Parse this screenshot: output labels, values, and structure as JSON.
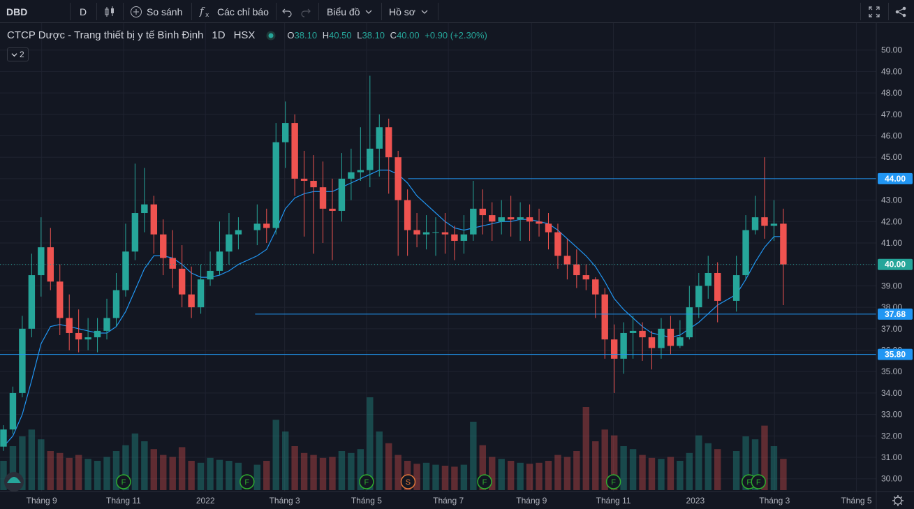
{
  "toolbar": {
    "symbol": "DBD",
    "interval": "D",
    "compare_label": "So sánh",
    "indicators_label": "Các chỉ báo",
    "chart_type_label": "Biểu đồ",
    "profile_label": "Hồ sơ"
  },
  "legend": {
    "title": "CTCP Dược - Trang thiết bị y tế Bình Định",
    "interval": "1D",
    "exchange": "HSX",
    "o_label": "O",
    "o_value": "38.10",
    "h_label": "H",
    "h_value": "40.50",
    "l_label": "L",
    "l_value": "38.10",
    "c_label": "C",
    "c_value": "40.00",
    "change": "+0.90 (+2.30%)",
    "collapsed_count": "2"
  },
  "colors": {
    "background": "#131722",
    "up": "#26a69a",
    "down": "#ef5350",
    "ma": "#2196f3",
    "hline": "#2196f3",
    "dividend_marker": "#2ead2e",
    "split_marker": "#e0763a"
  },
  "chart_data": {
    "type": "candlestick",
    "series": [
      {
        "name": "DBD",
        "x": [
          "2021-08-02",
          "2021-08-09",
          "2021-08-16",
          "2021-08-23",
          "2021-08-30",
          "2021-09-06",
          "2021-09-13",
          "2021-09-20",
          "2021-09-27",
          "2021-10-04",
          "2021-10-11",
          "2021-10-18",
          "2021-10-25",
          "2021-11-01",
          "2021-11-08",
          "2021-11-15",
          "2021-11-22",
          "2021-11-29",
          "2021-12-06",
          "2021-12-13",
          "2021-12-20",
          "2021-12-27",
          "2022-01-03",
          "2022-01-10",
          "2022-01-17",
          "2022-01-24",
          "2022-02-07",
          "2022-02-14",
          "2022-02-21",
          "2022-02-28",
          "2022-03-07",
          "2022-03-14",
          "2022-03-21",
          "2022-03-28",
          "2022-04-04",
          "2022-04-11",
          "2022-04-18",
          "2022-04-25",
          "2022-05-02",
          "2022-05-09",
          "2022-05-16",
          "2022-05-23",
          "2022-05-30",
          "2022-06-06",
          "2022-06-13",
          "2022-06-20",
          "2022-06-27",
          "2022-07-04",
          "2022-07-11",
          "2022-07-18",
          "2022-07-25",
          "2022-08-01",
          "2022-08-08",
          "2022-08-15",
          "2022-08-22",
          "2022-08-29",
          "2022-09-05",
          "2022-09-12",
          "2022-09-19",
          "2022-09-26",
          "2022-10-03",
          "2022-10-10",
          "2022-10-17",
          "2022-10-24",
          "2022-10-31",
          "2022-11-07",
          "2022-11-14",
          "2022-11-21",
          "2022-11-28",
          "2022-12-05",
          "2022-12-12",
          "2022-12-19",
          "2022-12-26",
          "2023-01-02",
          "2023-01-09",
          "2023-01-16",
          "2023-01-30",
          "2023-02-06",
          "2023-02-13",
          "2023-02-20",
          "2023-02-27",
          "2023-03-06"
        ],
        "open": [
          31.5,
          32.3,
          34.0,
          37.0,
          39.5,
          40.8,
          39.2,
          37.5,
          36.8,
          36.5,
          36.6,
          36.9,
          37.5,
          38.8,
          40.6,
          42.4,
          42.8,
          41.4,
          40.3,
          39.8,
          38.6,
          38.0,
          39.3,
          39.7,
          40.6,
          41.4,
          41.6,
          41.9,
          41.7,
          45.7,
          46.6,
          44.0,
          43.9,
          43.6,
          42.6,
          42.5,
          44.0,
          44.3,
          44.4,
          45.4,
          46.4,
          45.0,
          43.0,
          41.6,
          41.4,
          41.5,
          41.5,
          41.4,
          41.1,
          41.4,
          42.6,
          42.3,
          42.0,
          42.2,
          42.1,
          42.2,
          42.0,
          41.9,
          41.5,
          40.4,
          40.0,
          39.5,
          39.3,
          38.6,
          36.5,
          35.6,
          36.8,
          36.9,
          36.6,
          36.1,
          37.0,
          36.2,
          36.6,
          38.0,
          39.0,
          39.6,
          38.3,
          39.5,
          41.6,
          42.2,
          41.8,
          41.9
        ],
        "close": [
          32.3,
          34.0,
          37.0,
          39.5,
          40.8,
          39.2,
          37.5,
          36.8,
          36.5,
          36.6,
          36.9,
          37.5,
          38.8,
          40.6,
          42.4,
          42.8,
          41.4,
          40.3,
          39.8,
          38.6,
          38.0,
          39.3,
          39.7,
          40.6,
          41.4,
          41.6,
          41.9,
          41.7,
          45.7,
          46.6,
          44.0,
          43.9,
          43.6,
          42.6,
          42.5,
          44.0,
          44.3,
          44.4,
          45.4,
          46.4,
          45.0,
          43.0,
          41.6,
          41.4,
          41.5,
          41.5,
          41.4,
          41.1,
          41.4,
          42.6,
          42.3,
          42.0,
          42.2,
          42.1,
          42.2,
          42.0,
          41.9,
          41.5,
          40.4,
          40.0,
          39.5,
          39.3,
          38.6,
          36.5,
          35.6,
          36.8,
          36.9,
          36.6,
          36.1,
          37.0,
          36.2,
          36.6,
          38.0,
          39.0,
          39.6,
          38.3,
          39.5,
          41.6,
          42.2,
          41.8,
          41.9,
          40.0
        ],
        "high": [
          32.5,
          34.3,
          37.6,
          40.5,
          42.2,
          41.7,
          40.0,
          38.6,
          37.9,
          37.5,
          37.5,
          38.4,
          39.6,
          41.9,
          44.7,
          44.5,
          43.2,
          42.1,
          41.6,
          40.9,
          39.9,
          40.0,
          40.6,
          42.0,
          42.4,
          42.2,
          42.8,
          42.6,
          46.6,
          47.6,
          47.0,
          45.3,
          45.1,
          44.8,
          44.0,
          45.2,
          45.4,
          46.4,
          48.8,
          47.0,
          46.8,
          45.3,
          43.5,
          42.4,
          42.3,
          42.2,
          42.4,
          41.8,
          42.3,
          43.9,
          43.5,
          42.9,
          43.0,
          43.2,
          42.9,
          42.8,
          42.6,
          42.4,
          41.9,
          41.2,
          40.7,
          40.0,
          39.4,
          38.9,
          37.2,
          37.3,
          37.6,
          37.3,
          36.9,
          37.5,
          37.6,
          37.4,
          39.0,
          39.6,
          40.4,
          40.1,
          40.4,
          42.3,
          43.2,
          45.0,
          43.0,
          42.6
        ],
        "low": [
          31.3,
          32.1,
          33.8,
          36.6,
          38.5,
          38.8,
          36.7,
          36.0,
          35.9,
          36.0,
          35.9,
          36.5,
          37.1,
          38.5,
          40.2,
          41.5,
          40.5,
          39.5,
          38.9,
          38.0,
          37.5,
          37.7,
          39.0,
          39.5,
          40.0,
          40.7,
          40.9,
          41.0,
          41.4,
          44.5,
          43.2,
          41.3,
          40.5,
          41.0,
          40.2,
          42.0,
          43.0,
          43.9,
          43.6,
          44.1,
          43.3,
          40.4,
          40.4,
          40.8,
          40.7,
          40.4,
          40.5,
          40.2,
          40.5,
          41.1,
          41.4,
          41.1,
          41.4,
          41.3,
          41.1,
          41.1,
          41.3,
          40.7,
          39.8,
          39.3,
          38.9,
          38.8,
          37.5,
          35.6,
          34.0,
          34.9,
          35.6,
          35.5,
          35.1,
          35.6,
          35.8,
          36.1,
          36.5,
          37.5,
          38.4,
          37.3,
          37.8,
          39.3,
          41.4,
          41.2,
          41.1,
          38.1
        ]
      },
      {
        "name": "MA",
        "values": [
          31.5,
          32.0,
          33.0,
          34.6,
          36.3,
          37.1,
          37.2,
          37.1,
          37.0,
          36.9,
          36.8,
          36.8,
          37.1,
          37.8,
          38.8,
          39.8,
          40.4,
          40.4,
          40.3,
          40.0,
          39.6,
          39.4,
          39.4,
          39.5,
          39.7,
          40.0,
          40.4,
          40.7,
          41.6,
          42.6,
          43.1,
          43.3,
          43.4,
          43.4,
          43.4,
          43.6,
          43.8,
          44.0,
          44.2,
          44.4,
          44.4,
          44.2,
          43.8,
          43.2,
          42.8,
          42.4,
          42.0,
          41.7,
          41.6,
          41.7,
          41.8,
          41.9,
          42.0,
          42.0,
          42.1,
          42.1,
          42.0,
          41.9,
          41.6,
          41.2,
          40.8,
          40.4,
          39.9,
          39.2,
          38.4,
          37.9,
          37.5,
          37.1,
          36.8,
          36.7,
          36.6,
          36.7,
          37.0,
          37.3,
          37.7,
          38.1,
          38.6,
          39.3,
          40.1,
          40.8,
          41.3,
          41.3
        ]
      }
    ],
    "volume": [
      0.3,
      0.45,
      0.55,
      0.62,
      0.52,
      0.4,
      0.38,
      0.33,
      0.36,
      0.32,
      0.3,
      0.34,
      0.4,
      0.46,
      0.58,
      0.5,
      0.42,
      0.36,
      0.34,
      0.44,
      0.3,
      0.28,
      0.33,
      0.31,
      0.3,
      0.28,
      0.26,
      0.3,
      0.72,
      0.6,
      0.45,
      0.38,
      0.36,
      0.33,
      0.34,
      0.4,
      0.38,
      0.42,
      0.95,
      0.6,
      0.48,
      0.36,
      0.3,
      0.27,
      0.28,
      0.26,
      0.25,
      0.24,
      0.26,
      0.7,
      0.46,
      0.34,
      0.32,
      0.3,
      0.28,
      0.27,
      0.28,
      0.3,
      0.36,
      0.34,
      0.4,
      0.85,
      0.5,
      0.62,
      0.56,
      0.45,
      0.42,
      0.36,
      0.33,
      0.32,
      0.34,
      0.3,
      0.38,
      0.56,
      0.48,
      0.42,
      0.4,
      0.55,
      0.52,
      0.66,
      0.45,
      0.32
    ],
    "price_levels": [
      44.0,
      37.68,
      35.8
    ],
    "last_price": "40.00",
    "y_ticks": [
      "50.00",
      "49.00",
      "48.00",
      "47.00",
      "46.00",
      "45.00",
      "44.00",
      "43.00",
      "42.00",
      "41.00",
      "40.00",
      "39.00",
      "38.00",
      "37.00",
      "36.00",
      "35.00",
      "34.00",
      "33.00",
      "32.00",
      "31.00",
      "30.00"
    ],
    "ylim": [
      29.6,
      51.0
    ],
    "x_labels": [
      {
        "label": "Tháng 9",
        "date": "2021-09-01"
      },
      {
        "label": "Tháng 11",
        "date": "2021-11-01"
      },
      {
        "label": "2022",
        "date": "2022-01-01"
      },
      {
        "label": "Tháng 3",
        "date": "2022-03-01"
      },
      {
        "label": "Tháng 5",
        "date": "2022-05-01"
      },
      {
        "label": "Tháng 7",
        "date": "2022-07-01"
      },
      {
        "label": "Tháng 9",
        "date": "2022-09-01"
      },
      {
        "label": "Tháng 11",
        "date": "2022-11-01"
      },
      {
        "label": "2023",
        "date": "2023-01-01"
      },
      {
        "label": "Tháng 3",
        "date": "2023-03-01"
      },
      {
        "label": "Tháng 5",
        "date": "2023-05-01"
      }
    ],
    "markers": [
      {
        "type": "F",
        "date": "2021-11-01"
      },
      {
        "type": "F",
        "date": "2022-02-01"
      },
      {
        "type": "F",
        "date": "2022-05-01"
      },
      {
        "type": "S",
        "date": "2022-06-01"
      },
      {
        "type": "F",
        "date": "2022-07-28"
      },
      {
        "type": "F",
        "date": "2022-11-01"
      },
      {
        "type": "F",
        "date": "2023-02-10"
      },
      {
        "type": "F",
        "date": "2023-02-17"
      }
    ]
  }
}
